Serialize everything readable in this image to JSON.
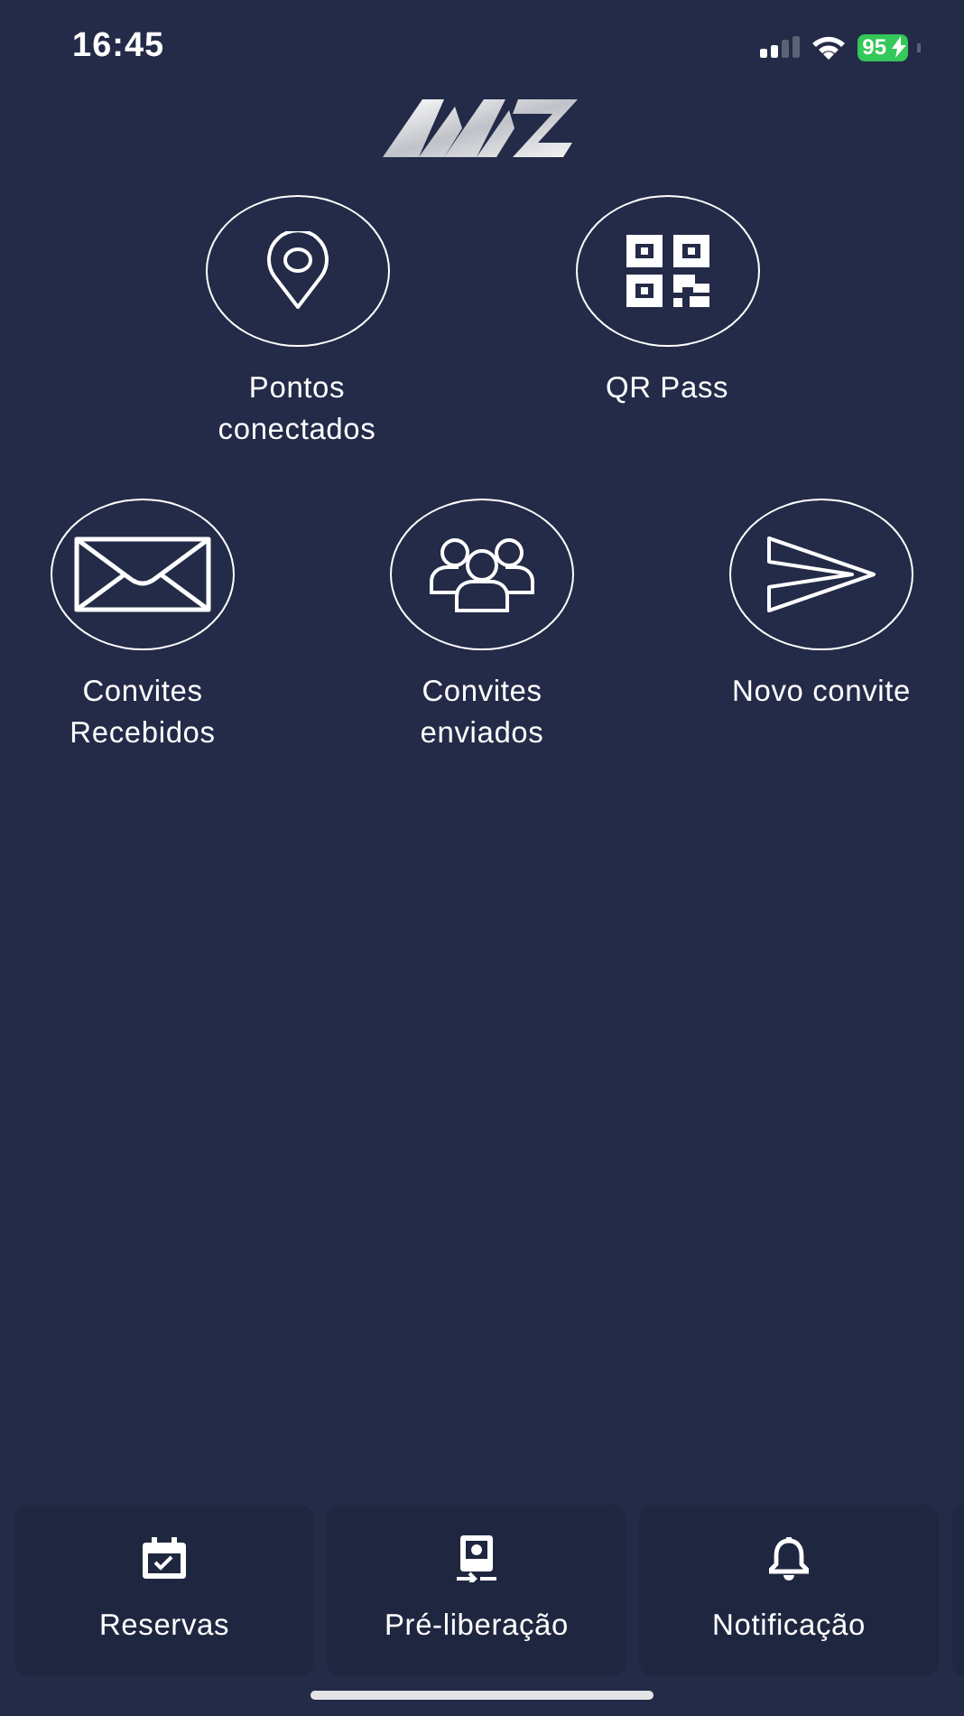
{
  "status_bar": {
    "time": "16:45",
    "battery": "95"
  },
  "menu_rows": [
    [
      {
        "label": "Pontos conectados"
      },
      {
        "label": "QR Pass"
      }
    ],
    [
      {
        "label": "Convites Recebidos"
      },
      {
        "label": "Convites enviados"
      },
      {
        "label": "Novo convite"
      }
    ]
  ],
  "bottom_tabs": [
    {
      "label": "Reservas"
    },
    {
      "label": "Pré-liberação"
    },
    {
      "label": "Notificação"
    }
  ]
}
